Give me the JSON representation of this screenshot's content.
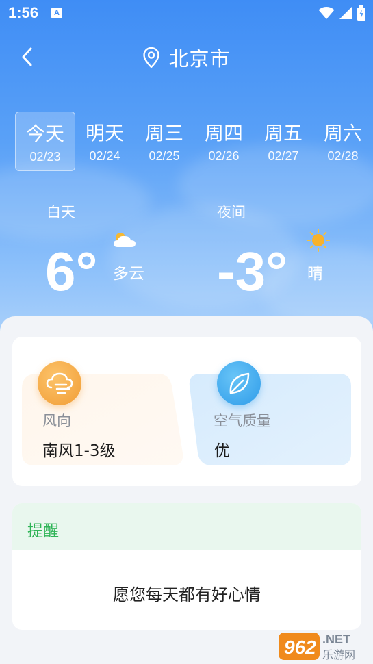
{
  "status_bar": {
    "time": "1:56",
    "notification_glyph": "A",
    "icons": [
      "wifi-icon",
      "signal-icon",
      "battery-icon"
    ]
  },
  "header": {
    "back_icon": "chevron-left-icon",
    "location_icon": "location-pin-icon",
    "city": "北京市"
  },
  "days": [
    {
      "name": "今天",
      "date": "02/23",
      "active": true
    },
    {
      "name": "明天",
      "date": "02/24",
      "active": false
    },
    {
      "name": "周三",
      "date": "02/25",
      "active": false
    },
    {
      "name": "周四",
      "date": "02/26",
      "active": false
    },
    {
      "name": "周五",
      "date": "02/27",
      "active": false
    },
    {
      "name": "周六",
      "date": "02/28",
      "active": false
    }
  ],
  "forecast": {
    "day": {
      "label": "白天",
      "temp": "6°",
      "condition": "多云",
      "icon": "partly-cloudy-icon"
    },
    "night": {
      "label": "夜间",
      "temp": "-3°",
      "condition": "晴",
      "icon": "sun-icon"
    }
  },
  "details": {
    "wind": {
      "label": "风向",
      "value": "南风1-3级",
      "icon": "wind-cloud-icon"
    },
    "air": {
      "label": "空气质量",
      "value": "优",
      "icon": "leaf-icon"
    }
  },
  "reminder": {
    "title": "提醒",
    "message": "愿您每天都有好心情"
  },
  "watermark": {
    "brand": "962",
    "suffix": ".NET",
    "subtitle": "乐游网"
  },
  "colors": {
    "sky_top": "#3f8df5",
    "reminder_green": "#2fb457",
    "wind_orange": "#f5a540",
    "air_blue": "#3ea7ee"
  }
}
